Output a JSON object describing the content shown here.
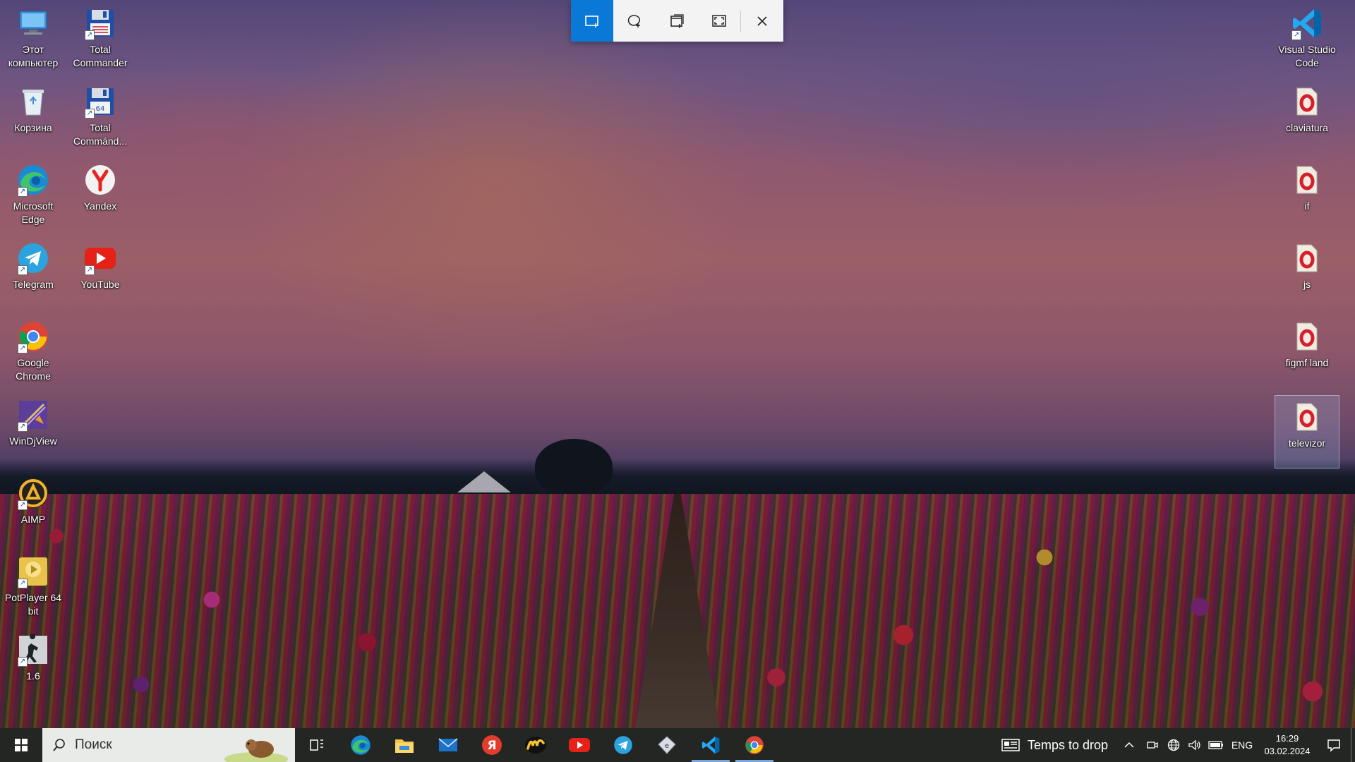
{
  "wallpaper": {
    "description_colors": {
      "sky_top": "#6b5b9a",
      "sky_mid": "#c77a86",
      "field": "#3a1a20"
    }
  },
  "snip_toolbar": {
    "buttons": [
      {
        "name": "rect-snip",
        "icon": "rectangle-snip-icon",
        "active": true
      },
      {
        "name": "freeform-snip",
        "icon": "freeform-snip-icon",
        "active": false
      },
      {
        "name": "window-snip",
        "icon": "window-snip-icon",
        "active": false
      },
      {
        "name": "fullscreen-snip",
        "icon": "fullscreen-snip-icon",
        "active": false
      }
    ],
    "close_icon": "close-icon",
    "accent": "#0a78d6"
  },
  "desktop_left_col1": [
    {
      "label": "Этот компьютер",
      "icon": "computer-icon"
    },
    {
      "label": "Корзина",
      "icon": "recycle-bin-icon"
    },
    {
      "label": "Microsoft Edge",
      "icon": "edge-icon"
    },
    {
      "label": "Telegram",
      "icon": "telegram-icon"
    },
    {
      "label": "Google Chrome",
      "icon": "chrome-icon"
    },
    {
      "label": "WinDjView",
      "icon": "windjview-icon"
    },
    {
      "label": "AIMP",
      "icon": "aimp-icon"
    },
    {
      "label": "PotPlayer 64 bit",
      "icon": "potplayer-icon"
    },
    {
      "label": "1.6",
      "icon": "counter-strike-icon"
    }
  ],
  "desktop_left_col2": [
    {
      "label": "Total Commander",
      "icon": "total-commander-icon"
    },
    {
      "label": "Total Commánd...",
      "icon": "total-commander-64-icon"
    },
    {
      "label": "Yandex",
      "icon": "yandex-browser-icon"
    },
    {
      "label": "YouTube",
      "icon": "youtube-icon"
    }
  ],
  "desktop_right": [
    {
      "label": "Visual Studio Code",
      "icon": "vscode-icon",
      "selected": false
    },
    {
      "label": "claviatura",
      "icon": "opera-icon",
      "selected": false
    },
    {
      "label": "if",
      "icon": "opera-icon",
      "selected": false
    },
    {
      "label": "js",
      "icon": "opera-icon",
      "selected": false
    },
    {
      "label": "figmf land",
      "icon": "opera-icon",
      "selected": false
    },
    {
      "label": "televizor",
      "icon": "opera-icon",
      "selected": true
    }
  ],
  "taskbar": {
    "search_placeholder": "Поиск",
    "apps": [
      {
        "name": "task-view",
        "icon": "task-view-icon",
        "active": false
      },
      {
        "name": "edge",
        "icon": "edge-icon",
        "active": false
      },
      {
        "name": "file-explorer",
        "icon": "folder-icon",
        "active": false
      },
      {
        "name": "mail",
        "icon": "mail-icon",
        "active": false
      },
      {
        "name": "yandex",
        "icon": "yandex-browser-icon",
        "active": false
      },
      {
        "name": "yandex-music",
        "icon": "yandex-music-icon",
        "active": false
      },
      {
        "name": "youtube",
        "icon": "youtube-icon",
        "active": false
      },
      {
        "name": "telegram",
        "icon": "telegram-icon",
        "active": false
      },
      {
        "name": "windjview",
        "icon": "windjview-icon",
        "active": false
      },
      {
        "name": "vscode",
        "icon": "vscode-icon",
        "active": true
      },
      {
        "name": "chrome",
        "icon": "chrome-icon",
        "active": true
      }
    ],
    "weather_text": "Temps to drop",
    "language": "ENG",
    "time": "16:29",
    "date": "03.02.2024"
  }
}
